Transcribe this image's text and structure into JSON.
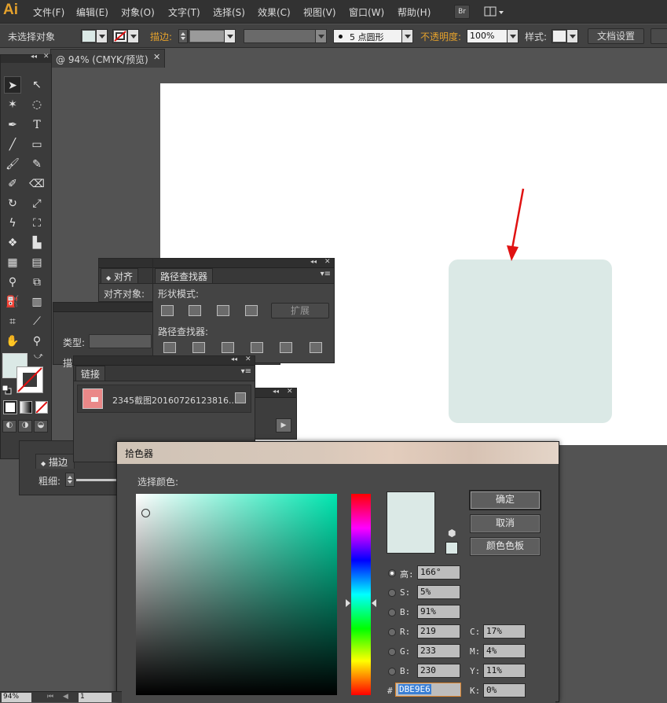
{
  "app": {
    "logo": "Ai"
  },
  "menu": [
    "文件(F)",
    "编辑(E)",
    "对象(O)",
    "文字(T)",
    "选择(S)",
    "效果(C)",
    "视图(V)",
    "窗口(W)",
    "帮助(H)"
  ],
  "menu_icons": {
    "bridge": "Br"
  },
  "control": {
    "selection": "未选择对象",
    "stroke_label": "描边:",
    "opacity_label": "不透明度:",
    "opacity_value": "100%",
    "brush_value": "5 点圆形",
    "style_label": "样式:",
    "doc_setup": "文档设置"
  },
  "document": {
    "tab_title": "@ 94% (CMYK/预览)",
    "fill_color": "#dbe9e6"
  },
  "align_panel": {
    "tab": "对齐",
    "row_label": "对齐对象:"
  },
  "pathfinder": {
    "tab": "路径查找器",
    "shape_modes": "形状模式:",
    "expand": "扩展",
    "pathfinders": "路径查找器:"
  },
  "hidden_panel": {
    "type_label": "类型:",
    "desc_label": "描"
  },
  "links": {
    "tab": "链接",
    "item": "2345截图20160726123816..."
  },
  "stroke_panel": {
    "tab": "描边",
    "weight_label": "粗细:"
  },
  "picker": {
    "title": "拾色器",
    "select_label": "选择颜色:",
    "ok": "确定",
    "cancel": "取消",
    "swatches": "颜色色板",
    "current_color": "#dbe9e6",
    "fields": {
      "h": {
        "label": "高:",
        "value": "166°"
      },
      "s": {
        "label": "S:",
        "value": "5%"
      },
      "b": {
        "label": "B:",
        "value": "91%"
      },
      "r": {
        "label": "R:",
        "value": "219"
      },
      "g": {
        "label": "G:",
        "value": "233"
      },
      "bl": {
        "label": "B:",
        "value": "230"
      },
      "hex_label": "#",
      "hex": "DBE9E6",
      "c": {
        "label": "C:",
        "value": "17%"
      },
      "m": {
        "label": "M:",
        "value": "4%"
      },
      "y": {
        "label": "Y:",
        "value": "11%"
      },
      "k": {
        "label": "K:",
        "value": "0%"
      }
    }
  },
  "status": {
    "zoom": "94%",
    "page": "1"
  }
}
